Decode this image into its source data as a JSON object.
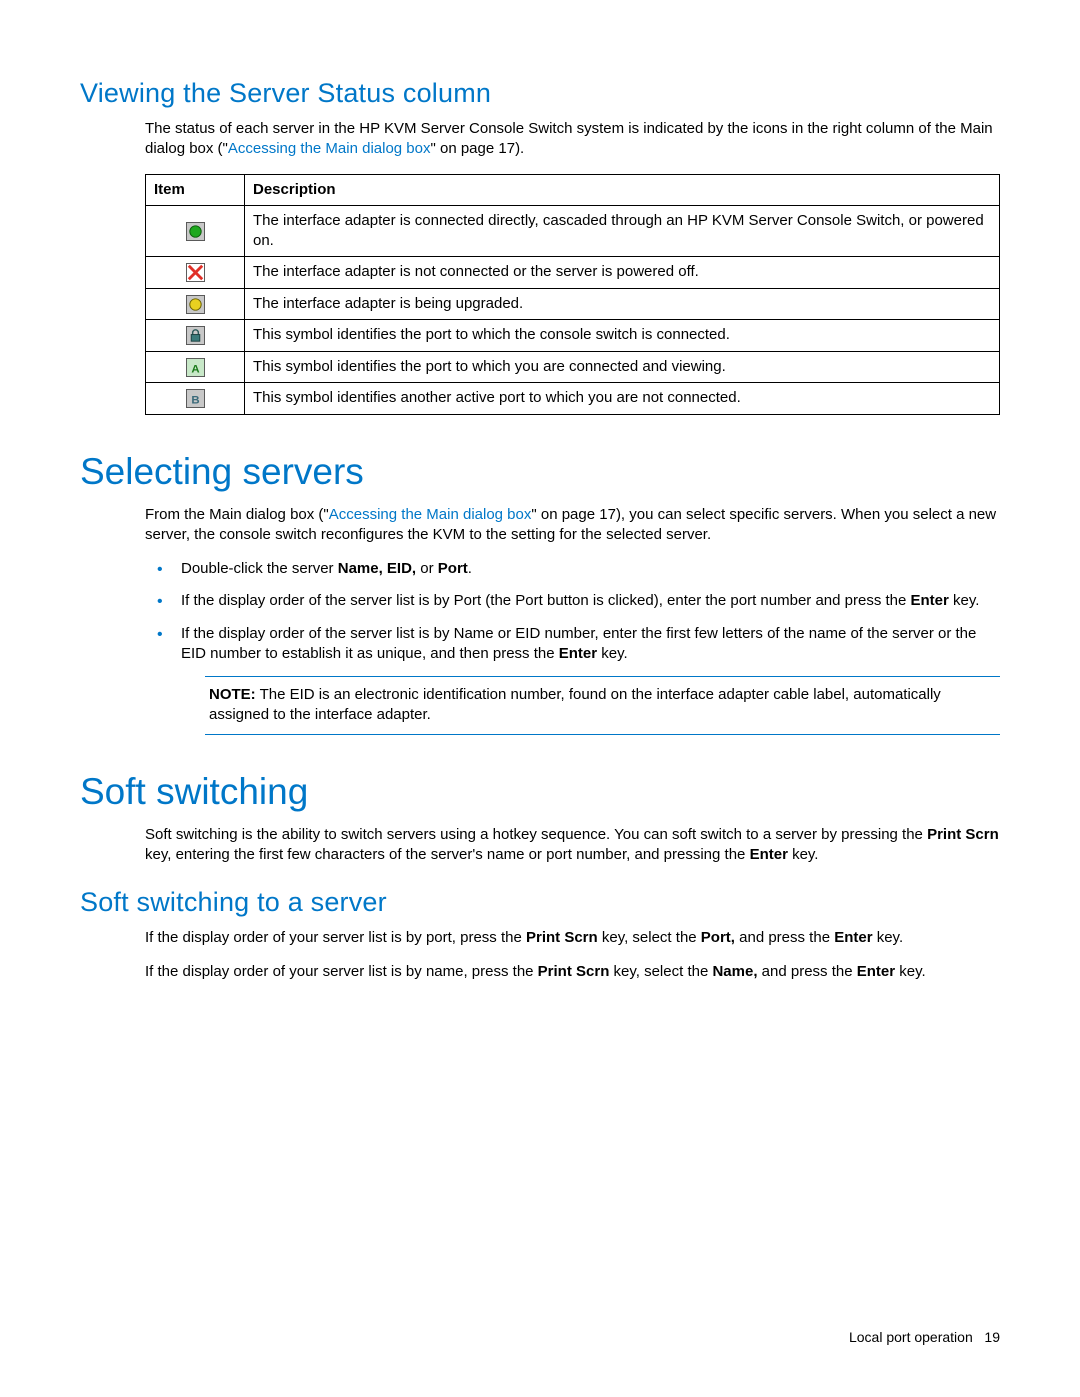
{
  "h2_viewing": "Viewing the Server Status column",
  "p_viewing_1a": "The status of each server in the HP KVM Server Console Switch system is indicated by the icons in the right column of the Main dialog box (\"",
  "xref_main1": "Accessing the Main dialog box",
  "p_viewing_1b": "\" on page 17).",
  "table": {
    "h_item": "Item",
    "h_desc": "Description",
    "rows": [
      {
        "icon": "green-circle",
        "desc": "The interface adapter is connected directly, cascaded through an HP KVM Server Console Switch, or powered on."
      },
      {
        "icon": "red-x",
        "desc": "The interface adapter is not connected or the server is powered off."
      },
      {
        "icon": "yellow-circle",
        "desc": "The interface adapter is being upgraded."
      },
      {
        "icon": "gray-lock",
        "desc": "This symbol identifies the port to which the console switch is connected."
      },
      {
        "icon": "green-a",
        "desc": "This symbol identifies the port to which you are connected and viewing."
      },
      {
        "icon": "gray-b",
        "desc": "This symbol identifies another active port to which you are not connected."
      }
    ]
  },
  "h1_selecting": "Selecting servers",
  "p_sel_1a": "From the Main dialog box (\"",
  "xref_main2": "Accessing the Main dialog box",
  "p_sel_1b": "\" on page 17), you can select specific servers. When you select a new server, the console switch reconfigures the KVM to the setting for the selected server.",
  "bullets": {
    "b1_a": "Double-click the server ",
    "b1_bold": "Name, EID,",
    "b1_b": " or ",
    "b1_bold2": "Port",
    "b1_c": ".",
    "b2_a": "If the display order of the server list is by Port (the Port button is clicked), enter the port number and press the ",
    "b2_bold": "Enter",
    "b2_b": " key.",
    "b3_a": "If the display order of the server list is by Name or EID number, enter the first few letters of the name of the server or the EID number to establish it as unique, and then press the ",
    "b3_bold": "Enter",
    "b3_b": " key."
  },
  "note_label": "NOTE:",
  "note_text": "  The EID is an electronic identification number, found on the interface adapter cable label, automatically assigned to the interface adapter.",
  "h1_soft": "Soft switching",
  "p_soft_a": "Soft switching is the ability to switch servers using a hotkey sequence. You can soft switch to a server by pressing the ",
  "p_soft_bold1": "Print Scrn",
  "p_soft_b": " key, entering the first few characters of the server's name or port number, and pressing the ",
  "p_soft_bold2": "Enter",
  "p_soft_c": " key.",
  "h2_soft_to": "Soft switching to a server",
  "p_ss1_a": "If the display order of your server list is by port, press the ",
  "p_ss1_bold1": "Print Scrn",
  "p_ss1_b": " key, select the ",
  "p_ss1_bold2": "Port,",
  "p_ss1_c": " and press the ",
  "p_ss1_bold3": "Enter",
  "p_ss1_d": " key.",
  "p_ss2_a": "If the display order of your server list is by name, press the ",
  "p_ss2_bold1": "Print Scrn",
  "p_ss2_b": " key, select the ",
  "p_ss2_bold2": "Name,",
  "p_ss2_c": " and press the ",
  "p_ss2_bold3": "Enter",
  "p_ss2_d": " key.",
  "footer_text": "Local port operation",
  "footer_page": "19"
}
